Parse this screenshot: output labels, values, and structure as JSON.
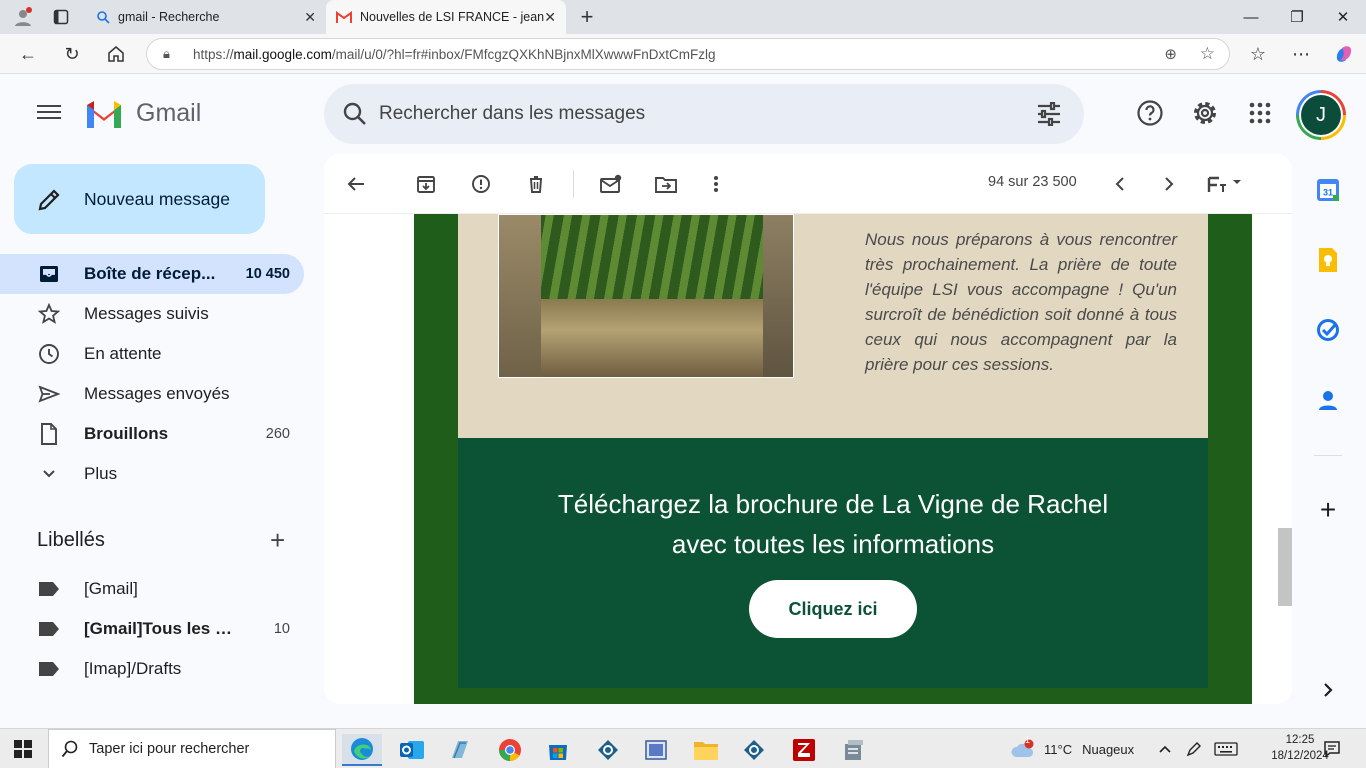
{
  "browser": {
    "tabs": [
      {
        "title": "gmail - Recherche"
      },
      {
        "title": "Nouvelles de LSI FRANCE - jeany"
      }
    ],
    "url_prefix": "https://",
    "url_host": "mail.google.com",
    "url_path": "/mail/u/0/?hl=fr#inbox/FMfcgzQXKhNBjnxMlXwwwFnDxtCmFzlg"
  },
  "gmail": {
    "brand": "Gmail",
    "search_placeholder": "Rechercher dans les messages",
    "avatar_initial": "J",
    "compose_label": "Nouveau message",
    "nav": [
      {
        "label": "Boîte de récep...",
        "count": "10 450"
      },
      {
        "label": "Messages suivis",
        "count": ""
      },
      {
        "label": "En attente",
        "count": ""
      },
      {
        "label": "Messages envoyés",
        "count": ""
      },
      {
        "label": "Brouillons",
        "count": "260"
      },
      {
        "label": "Plus",
        "count": ""
      }
    ],
    "labels_title": "Libellés",
    "labels": [
      {
        "label": "[Gmail]",
        "count": ""
      },
      {
        "label": "[Gmail]Tous les m...",
        "count": "10"
      },
      {
        "label": "[Imap]/Drafts",
        "count": ""
      }
    ],
    "pager": "94 sur 23 500",
    "calendar_day": "31"
  },
  "email": {
    "beige_text": "Nous nous préparons à vous rencontrer très prochainement. La prière de toute l'équipe LSI vous accompagne ! Qu'un surcroît de bénédiction soit donné à tous ceux qui nous accompagnent par la prière pour ces sessions.",
    "cta_line1": "Téléchargez la brochure de La Vigne de Rachel",
    "cta_line2": "avec toutes les informations",
    "cta_button": "Cliquez ici"
  },
  "taskbar": {
    "search_placeholder": "Taper ici pour rechercher",
    "weather_temp": "11°C",
    "weather_desc": "Nuageux",
    "weather_badge": "1",
    "time": "12:25",
    "date": "18/12/2024"
  },
  "colors": {
    "email_outer_green": "#1f5d1a",
    "email_cta_green": "#0c5335",
    "email_beige": "#e2d7c1",
    "compose_bg": "#c2e7ff",
    "active_nav_bg": "#d3e3fd"
  }
}
